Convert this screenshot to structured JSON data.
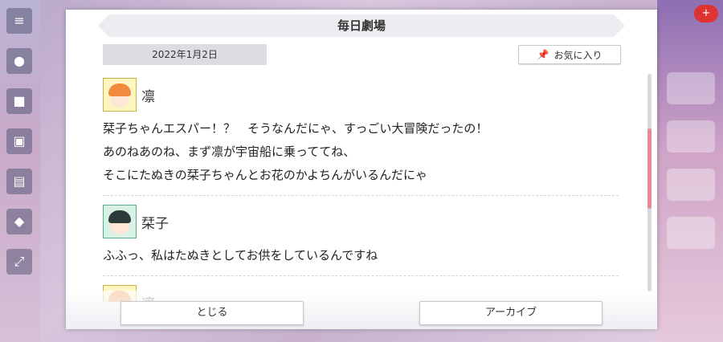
{
  "dialog": {
    "title": "毎日劇場",
    "date": "2022年1月2日",
    "favorite_label": "お気に入り"
  },
  "entries": [
    {
      "speaker": "凛",
      "lines": [
        "栞子ちゃんエスパー！？　そうなんだにゃ、すっごい大冒険だったの！",
        "あのねあのね、まず凛が宇宙船に乗っててね、",
        "そこにたぬきの栞子ちゃんとお花のかよちんがいるんだにゃ"
      ]
    },
    {
      "speaker": "栞子",
      "lines": [
        "ふふっ、私はたぬきとしてお供をしているんですね"
      ]
    },
    {
      "speaker": "凛",
      "lines": []
    }
  ],
  "buttons": {
    "close": "とじる",
    "archive": "アーカイブ"
  },
  "background": {
    "badge": "+"
  },
  "colors": {
    "scroll_thumb": "#e88a93",
    "banner": "#ececf1"
  }
}
